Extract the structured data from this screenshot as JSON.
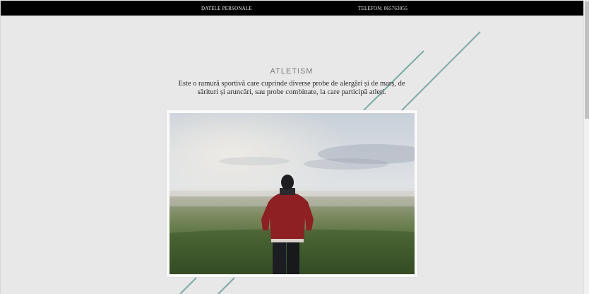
{
  "nav": {
    "personal_label": "DATELE PERSONALE",
    "phone_label": "TELEFON: 065763055"
  },
  "section": {
    "title": "ATLETISM",
    "description": "Este o ramură sportivă care cuprinde diverse probe de alergări și de marș, de sărituri și aruncări, sau probe combinate, la care participă atleți."
  },
  "colors": {
    "top_bar": "#000000",
    "background": "#e8e8e8",
    "accent_line": "#7aaba3",
    "title_text": "#7d7d7d"
  },
  "photo": {
    "subject": "man-red-jacket-in-misty-field"
  }
}
